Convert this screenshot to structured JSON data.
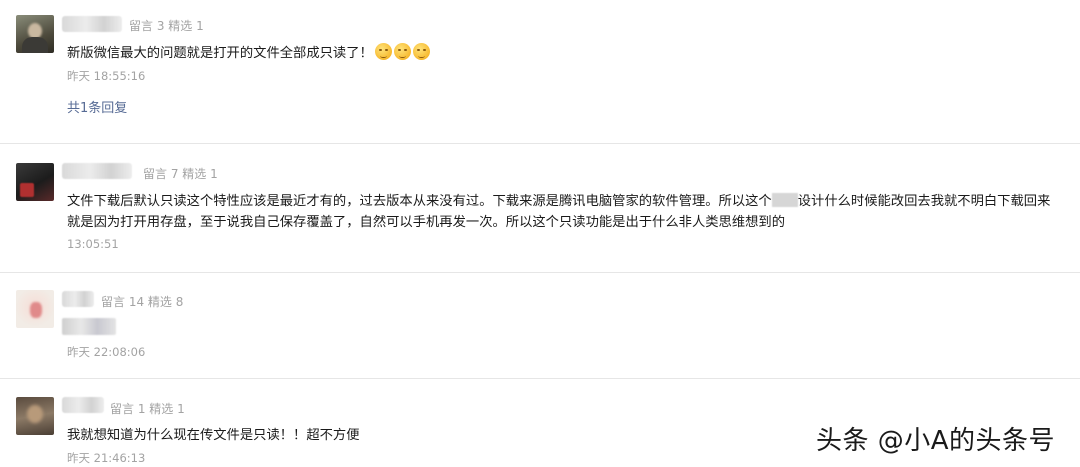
{
  "comments": [
    {
      "meta": "留言 3 精选 1",
      "text": "新版微信最大的问题就是打开的文件全部成只读了！",
      "emoji_count": 3,
      "time": "昨天 18:55:16",
      "replies": "共1条回复"
    },
    {
      "meta": "留言 7 精选 1",
      "text_line1_a": "文件下载后默认只读这个特性应该是最近才有的，过去版本从来没有过。下载来源是腾讯电脑管家的软件管理。所以这个",
      "text_line1_b": "设计什么时候能改回去我就不明白下载回来",
      "text_line2": "就是因为打开用存盘，至于说我自己保存覆盖了，自然可以手机再发一次。所以这个只读功能是出于什么非人类思维想到的",
      "time": "13:05:51"
    },
    {
      "meta": "留言 14 精选 8",
      "time": "昨天 22:08:06"
    },
    {
      "meta": "留言 1 精选 1",
      "text": "我就想知道为什么现在传文件是只读！！超不方便",
      "time": "昨天 21:46:13"
    }
  ],
  "watermark": "头条 @小A的头条号",
  "colors": {
    "link": "#576b95",
    "meta": "#a3a3a3",
    "divider": "#e6e6e6"
  }
}
